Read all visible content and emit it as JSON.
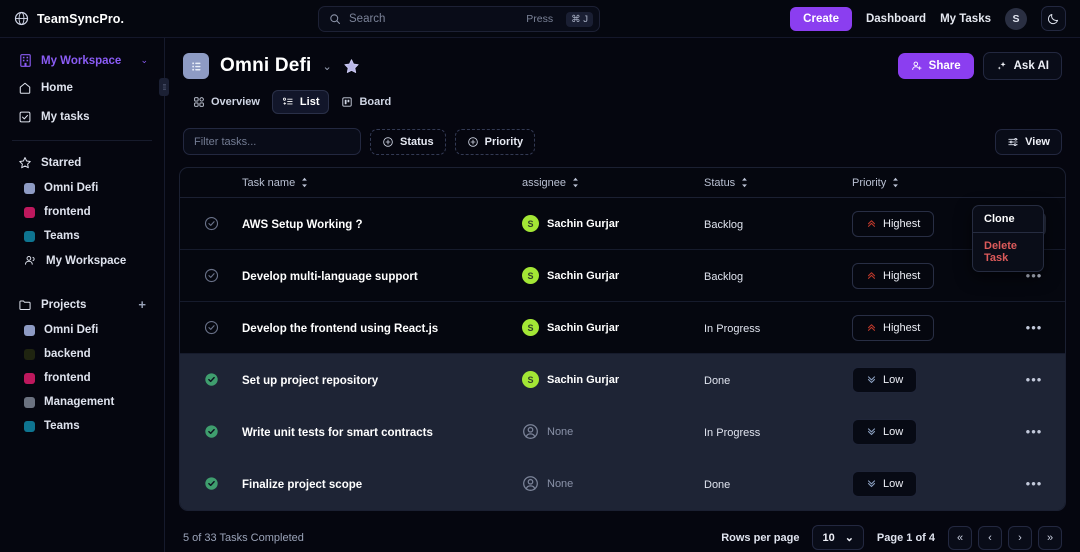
{
  "topbar": {
    "brand": "TeamSyncPro.",
    "brand_logo_icon": "globe-icon",
    "search": {
      "icon": "search-icon",
      "placeholder": "Search",
      "press_label": "Press",
      "kbd": "⌘ J"
    },
    "create_label": "Create",
    "nav": [
      {
        "label": "Dashboard"
      },
      {
        "label": "My Tasks"
      }
    ],
    "avatar_initial": "S",
    "theme_icon": "moon-icon",
    "accent": "#8b3ef0"
  },
  "sidebar": {
    "workspace": {
      "label": "My Workspace",
      "icon": "building-icon",
      "chevron": "⌄",
      "color": "#8b5cf6"
    },
    "nav": [
      {
        "label": "Home",
        "icon": "home-icon"
      },
      {
        "label": "My tasks",
        "icon": "check-square-icon"
      }
    ],
    "starred": {
      "label": "Starred",
      "icon": "star-icon"
    },
    "starred_items": [
      {
        "label": "Omni Defi",
        "color": "#8e9bc4",
        "icon": "project-swatch"
      },
      {
        "label": "frontend",
        "color": "#be185d",
        "icon": "project-swatch"
      },
      {
        "label": "Teams",
        "color": "#0e7490",
        "icon": "project-swatch"
      },
      {
        "label": "My Workspace",
        "color": "",
        "icon": "users-icon"
      }
    ],
    "projects": {
      "label": "Projects",
      "icon": "folder-icon",
      "add_icon": "plus-icon",
      "add_label": "+"
    },
    "project_items": [
      {
        "label": "Omni Defi",
        "color": "#8e9bc4"
      },
      {
        "label": "backend",
        "color": "#1f2410"
      },
      {
        "label": "frontend",
        "color": "#be185d"
      },
      {
        "label": "Management",
        "color": "#6b7280"
      },
      {
        "label": "Teams",
        "color": "#0e7490"
      }
    ],
    "resize_handle_icon": "drag-handle-icon"
  },
  "project": {
    "icon": "list-square-icon",
    "title": "Omni Defi",
    "chevron": "⌄",
    "star_icon": "star-filled-icon",
    "share_label": "Share",
    "share_icon": "user-plus-icon",
    "askai_label": "Ask AI",
    "askai_icon": "sparkles-icon",
    "tabs": [
      {
        "label": "Overview",
        "icon": "grid-icon",
        "active": false
      },
      {
        "label": "List",
        "icon": "list-icon",
        "active": true
      },
      {
        "label": "Board",
        "icon": "board-icon",
        "active": false
      }
    ]
  },
  "toolbar": {
    "filter_placeholder": "Filter tasks...",
    "filter_value": "",
    "status_chip": {
      "label": "Status",
      "icon": "plus-circle-icon"
    },
    "priority_chip": {
      "label": "Priority",
      "icon": "plus-circle-icon"
    },
    "view_label": "View",
    "view_icon": "sliders-icon"
  },
  "table": {
    "columns": [
      {
        "key": "task",
        "label": "Task name",
        "sort_icon": "sort-icon"
      },
      {
        "key": "assignee",
        "label": "assignee",
        "sort_icon": "sort-icon"
      },
      {
        "key": "status",
        "label": "Status",
        "sort_icon": "sort-icon"
      },
      {
        "key": "priority",
        "label": "Priority",
        "sort_icon": "sort-icon"
      }
    ],
    "rows": [
      {
        "task": "AWS Setup Working ?",
        "assignee": "Sachin Gurjar",
        "assignee_initial": "S",
        "has_avatar": true,
        "status": "Backlog",
        "priority": "Highest",
        "priority_icon": "chevrons-up-icon",
        "priority_color": "#c0392b",
        "checked": false,
        "selected": false,
        "menu_open": true
      },
      {
        "task": "Develop multi-language support",
        "assignee": "Sachin Gurjar",
        "assignee_initial": "S",
        "has_avatar": true,
        "status": "Backlog",
        "priority": "Highest",
        "priority_icon": "chevrons-up-icon",
        "priority_color": "#c0392b",
        "checked": false,
        "selected": false,
        "menu_open": false
      },
      {
        "task": "Develop the frontend using React.js",
        "assignee": "Sachin Gurjar",
        "assignee_initial": "S",
        "has_avatar": true,
        "status": "In Progress",
        "priority": "Highest",
        "priority_icon": "chevrons-up-icon",
        "priority_color": "#c0392b",
        "checked": false,
        "selected": false,
        "menu_open": false
      },
      {
        "task": "Set up project repository",
        "assignee": "Sachin Gurjar",
        "assignee_initial": "S",
        "has_avatar": true,
        "status": "Done",
        "priority": "Low",
        "priority_icon": "chevrons-down-icon",
        "priority_color": "#8ea3c4",
        "checked": true,
        "selected": true,
        "menu_open": false
      },
      {
        "task": "Write unit tests for smart contracts",
        "assignee": "None",
        "assignee_initial": "",
        "has_avatar": false,
        "status": "In Progress",
        "priority": "Low",
        "priority_icon": "chevrons-down-icon",
        "priority_color": "#8ea3c4",
        "checked": true,
        "selected": true,
        "menu_open": false
      },
      {
        "task": "Finalize project scope",
        "assignee": "None",
        "assignee_initial": "",
        "has_avatar": false,
        "status": "Done",
        "priority": "Low",
        "priority_icon": "chevrons-down-icon",
        "priority_color": "#8ea3c4",
        "checked": true,
        "selected": true,
        "menu_open": false
      }
    ],
    "context_menu": {
      "clone_label": "Clone",
      "delete_label": "Delete Task",
      "delete_color": "#dc5a5a"
    },
    "row_menu_icon": "ellipsis-icon"
  },
  "footer": {
    "completed_text": "5 of 33 Tasks Completed",
    "rows_per_page_label": "Rows per page",
    "rows_per_page_value": "10",
    "rows_per_page_chevron": "⌄",
    "page_text": "Page 1 of 4",
    "pagination": [
      {
        "label": "«",
        "name": "first-page-button"
      },
      {
        "label": "‹",
        "name": "prev-page-button"
      },
      {
        "label": "›",
        "name": "next-page-button"
      },
      {
        "label": "»",
        "name": "last-page-button"
      }
    ]
  }
}
